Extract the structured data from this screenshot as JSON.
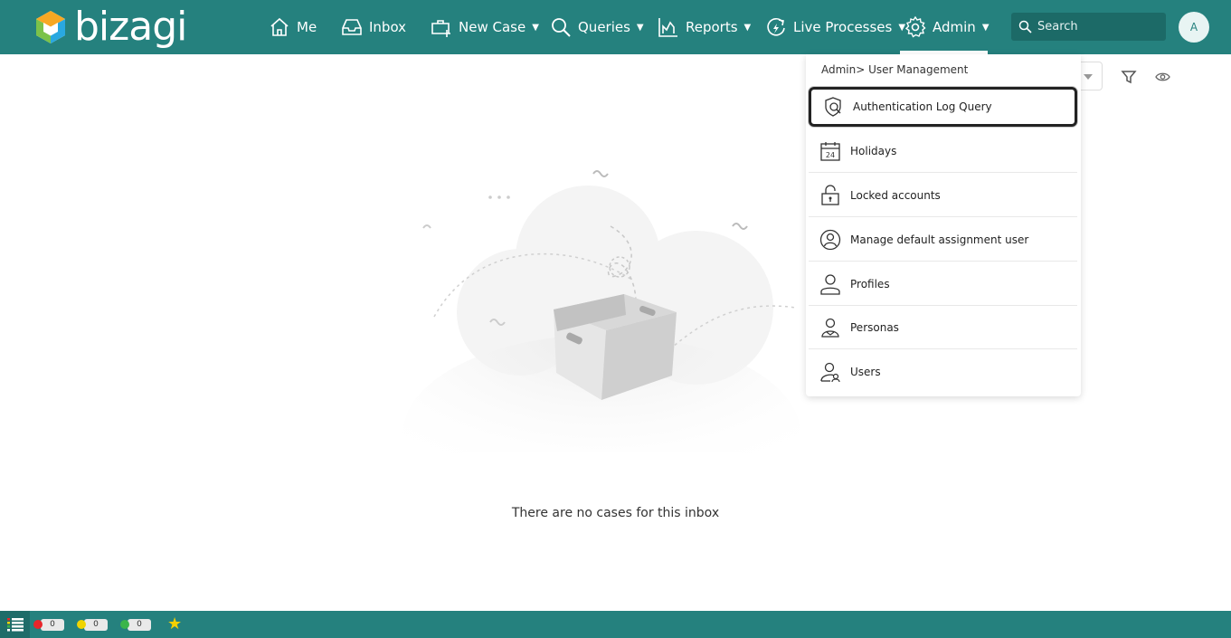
{
  "header": {
    "logo_text": "bizagi",
    "nav": [
      {
        "label": "Me",
        "icon": "home-icon"
      },
      {
        "label": "Inbox",
        "icon": "inbox-icon"
      },
      {
        "label": "New Case",
        "icon": "new-case-icon"
      },
      {
        "label": "Queries",
        "icon": "search-icon"
      },
      {
        "label": "Reports",
        "icon": "chart-icon"
      },
      {
        "label": "Live Processes",
        "icon": "live-process-icon"
      },
      {
        "label": "Admin",
        "icon": "gear-icon"
      }
    ],
    "search_placeholder": "Search",
    "avatar_initial": "A"
  },
  "main": {
    "empty_message": "There are no cases for this inbox"
  },
  "admin_menu": {
    "breadcrumb": "Admin> User Management",
    "items": [
      {
        "label": "Authentication Log Query",
        "icon": "auth-log-icon",
        "selected": true
      },
      {
        "label": "Holidays",
        "icon": "calendar-icon",
        "calendar_day": "24"
      },
      {
        "label": "Locked accounts",
        "icon": "lock-icon"
      },
      {
        "label": "Manage default assignment user",
        "icon": "assignment-user-icon"
      },
      {
        "label": "Profiles",
        "icon": "profile-icon"
      },
      {
        "label": "Personas",
        "icon": "personas-icon"
      },
      {
        "label": "Users",
        "icon": "users-icon"
      }
    ]
  },
  "footer": {
    "counters": [
      {
        "color": "#e8262b",
        "value": "0"
      },
      {
        "color": "#f0d400",
        "value": "0"
      },
      {
        "color": "#3bb54a",
        "value": "0"
      }
    ]
  },
  "colors": {
    "brand": "#25817e",
    "brand_dark": "#1c6a67"
  }
}
